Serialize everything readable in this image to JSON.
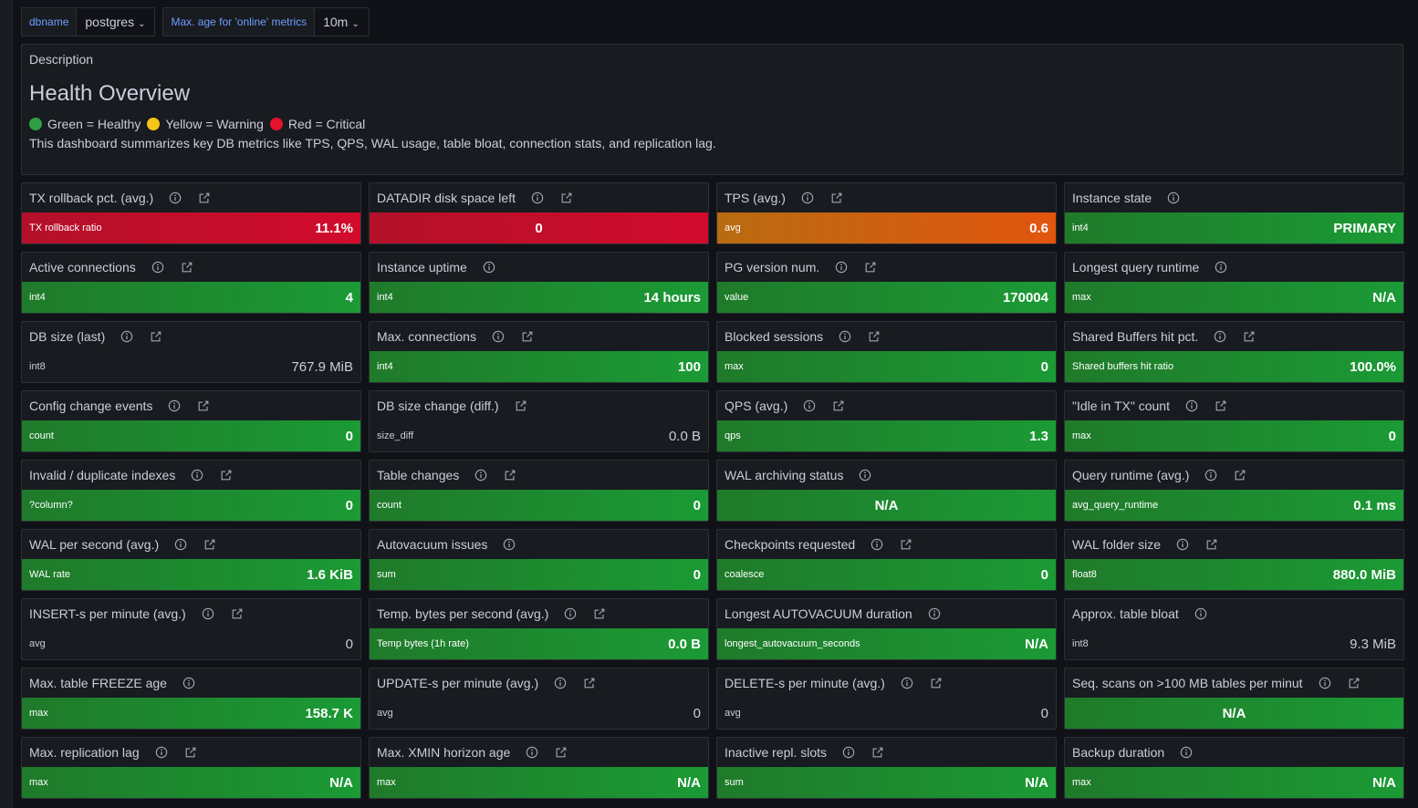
{
  "variables": [
    {
      "label": "dbname",
      "value": "postgres"
    },
    {
      "label": "Max. age for 'online' metrics",
      "value": "10m"
    }
  ],
  "description_panel": {
    "title": "Description",
    "heading": "Health Overview",
    "legend": [
      {
        "color": "#56a64b",
        "text": "Green = Healthy"
      },
      {
        "color": "#f2cc0c",
        "text": "Yellow = Warning"
      },
      {
        "color": "#e02f44",
        "text": "Red = Critical"
      }
    ],
    "text": "This dashboard summarizes key DB metrics like TPS, QPS, WAL usage, table bloat, connection stats, and replication lag."
  },
  "colors": {
    "green": "#1f9a33",
    "red": "#c8102e",
    "orange": "#d9600f"
  },
  "panels": [
    {
      "title": "TX rollback pct. (avg.)",
      "info": true,
      "link": true,
      "label": "TX rollback ratio",
      "value": "11.1%",
      "bg": "red"
    },
    {
      "title": "DATADIR disk space left",
      "info": true,
      "link": true,
      "label": "",
      "value": "0",
      "bg": "red",
      "center": true
    },
    {
      "title": "TPS (avg.)",
      "info": true,
      "link": true,
      "label": "avg",
      "value": "0.6",
      "bg": "orange"
    },
    {
      "title": "Instance state",
      "info": true,
      "link": false,
      "label": "int4",
      "value": "PRIMARY",
      "bg": "green"
    },
    {
      "title": "Active connections",
      "info": true,
      "link": true,
      "label": "int4",
      "value": "4",
      "bg": "green"
    },
    {
      "title": "Instance uptime",
      "info": true,
      "link": false,
      "label": "int4",
      "value": "14 hours",
      "bg": "green"
    },
    {
      "title": "PG version num.",
      "info": true,
      "link": true,
      "label": "value",
      "value": "170004",
      "bg": "green"
    },
    {
      "title": "Longest query runtime",
      "info": true,
      "link": false,
      "label": "max",
      "value": "N/A",
      "bg": "green"
    },
    {
      "title": "DB size (last)",
      "info": true,
      "link": true,
      "label": "int8",
      "value": "767.9 MiB",
      "bg": "plain"
    },
    {
      "title": "Max. connections",
      "info": true,
      "link": true,
      "label": "int4",
      "value": "100",
      "bg": "green"
    },
    {
      "title": "Blocked sessions",
      "info": true,
      "link": true,
      "label": "max",
      "value": "0",
      "bg": "green"
    },
    {
      "title": "Shared Buffers hit pct.",
      "info": true,
      "link": true,
      "label": "Shared buffers hit ratio",
      "value": "100.0%",
      "bg": "green"
    },
    {
      "title": "Config change events",
      "info": true,
      "link": true,
      "label": "count",
      "value": "0",
      "bg": "green"
    },
    {
      "title": "DB size change (diff.)",
      "info": false,
      "link": true,
      "label": "size_diff",
      "value": "0.0 B",
      "bg": "plain"
    },
    {
      "title": "QPS (avg.)",
      "info": true,
      "link": true,
      "label": "qps",
      "value": "1.3",
      "bg": "green"
    },
    {
      "title": "\"Idle in TX\" count",
      "info": true,
      "link": true,
      "label": "max",
      "value": "0",
      "bg": "green"
    },
    {
      "title": "Invalid / duplicate indexes",
      "info": true,
      "link": true,
      "label": "?column?",
      "value": "0",
      "bg": "green"
    },
    {
      "title": "Table changes",
      "info": true,
      "link": true,
      "label": "count",
      "value": "0",
      "bg": "green"
    },
    {
      "title": "WAL archiving status",
      "info": true,
      "link": false,
      "label": "",
      "value": "N/A",
      "bg": "green",
      "center": true
    },
    {
      "title": "Query runtime (avg.)",
      "info": true,
      "link": true,
      "label": "avg_query_runtime",
      "value": "0.1 ms",
      "bg": "green"
    },
    {
      "title": "WAL per second (avg.)",
      "info": true,
      "link": true,
      "label": "WAL rate",
      "value": "1.6 KiB",
      "bg": "green"
    },
    {
      "title": "Autovacuum issues",
      "info": true,
      "link": false,
      "label": "sum",
      "value": "0",
      "bg": "green"
    },
    {
      "title": "Checkpoints requested",
      "info": true,
      "link": true,
      "label": "coalesce",
      "value": "0",
      "bg": "green"
    },
    {
      "title": "WAL folder size",
      "info": true,
      "link": true,
      "label": "float8",
      "value": "880.0 MiB",
      "bg": "green"
    },
    {
      "title": "INSERT-s per minute (avg.)",
      "info": true,
      "link": true,
      "label": "avg",
      "value": "0",
      "bg": "plain"
    },
    {
      "title": "Temp. bytes per second (avg.)",
      "info": true,
      "link": true,
      "label": "Temp bytes (1h rate)",
      "value": "0.0 B",
      "bg": "green"
    },
    {
      "title": "Longest AUTOVACUUM duration",
      "info": true,
      "link": false,
      "label": "longest_autovacuum_seconds",
      "value": "N/A",
      "bg": "green"
    },
    {
      "title": "Approx. table bloat",
      "info": true,
      "link": false,
      "label": "int8",
      "value": "9.3 MiB",
      "bg": "plain"
    },
    {
      "title": "Max. table FREEZE age",
      "info": true,
      "link": false,
      "label": "max",
      "value": "158.7 K",
      "bg": "green"
    },
    {
      "title": "UPDATE-s per minute (avg.)",
      "info": true,
      "link": true,
      "label": "avg",
      "value": "0",
      "bg": "plain"
    },
    {
      "title": "DELETE-s per minute (avg.)",
      "info": true,
      "link": true,
      "label": "avg",
      "value": "0",
      "bg": "plain"
    },
    {
      "title": "Seq. scans on >100 MB tables per minut",
      "info": true,
      "link": true,
      "label": "",
      "value": "N/A",
      "bg": "green",
      "center": true
    },
    {
      "title": "Max. replication lag",
      "info": true,
      "link": true,
      "label": "max",
      "value": "N/A",
      "bg": "green"
    },
    {
      "title": "Max. XMIN horizon age",
      "info": true,
      "link": true,
      "label": "max",
      "value": "N/A",
      "bg": "green"
    },
    {
      "title": "Inactive repl. slots",
      "info": true,
      "link": true,
      "label": "sum",
      "value": "N/A",
      "bg": "green"
    },
    {
      "title": "Backup duration",
      "info": true,
      "link": false,
      "label": "max",
      "value": "N/A",
      "bg": "green"
    }
  ]
}
